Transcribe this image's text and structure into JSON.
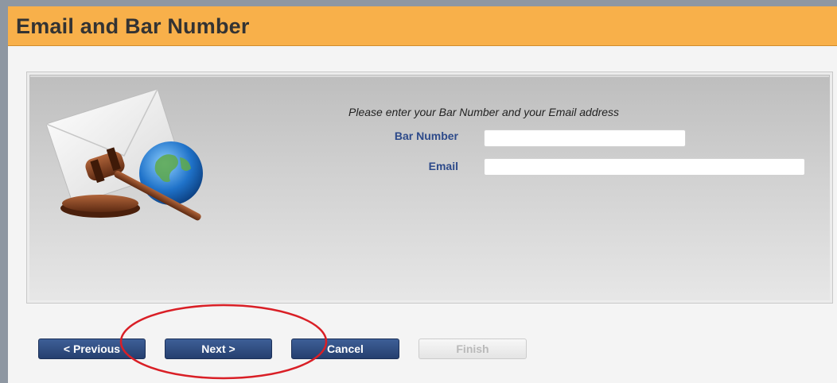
{
  "header": {
    "title": "Email and Bar Number"
  },
  "form": {
    "instructions": "Please enter your Bar Number and your Email address",
    "bar_number": {
      "label": "Bar Number",
      "value": "",
      "placeholder": ""
    },
    "email": {
      "label": "Email",
      "value": "",
      "placeholder": ""
    }
  },
  "buttons": {
    "previous": "< Previous",
    "next": "Next >",
    "cancel": "Cancel",
    "finish": "Finish"
  },
  "icons": {
    "illustration": [
      "envelope-icon",
      "gavel-icon",
      "globe-icon"
    ],
    "annotation": "red-ellipse-highlight"
  },
  "colors": {
    "header_bg": "#f8b04a",
    "button_bg": "#2f4c80",
    "label_text": "#2d4a8a",
    "annotation": "#d91f26"
  }
}
